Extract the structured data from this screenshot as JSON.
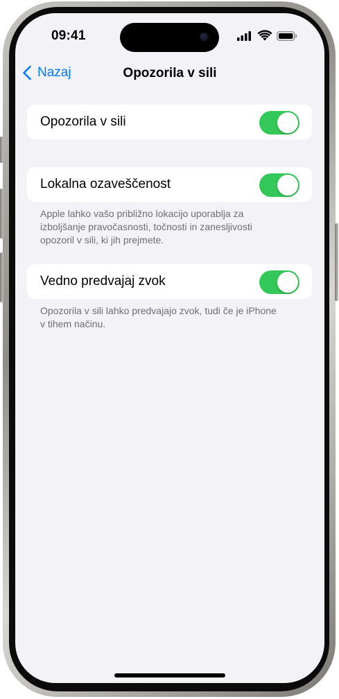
{
  "status_bar": {
    "time": "09:41",
    "icons": [
      "cellular-signal-icon",
      "wifi-icon",
      "battery-icon"
    ]
  },
  "nav": {
    "back_label": "Nazaj",
    "title": "Opozorila v sili"
  },
  "settings": [
    {
      "label": "Opozorila v sili",
      "enabled": true,
      "footnote": ""
    },
    {
      "label": "Lokalna ozaveščenost",
      "enabled": true,
      "footnote_lines": [
        "Apple lahko vašo približno lokacijo uporablja za",
        "izboljšanje pravočasnosti, točnosti in zanesljivosti",
        "opozoril v sili, ki jih prejmete."
      ]
    },
    {
      "label": "Vedno predvajaj zvok",
      "enabled": true,
      "footnote_lines": [
        "Opozorila v sili lahko predvajajo zvok, tudi če je iPhone",
        "v tihem načinu."
      ]
    }
  ],
  "colors": {
    "accent": "#007aff",
    "toggle_on": "#34c759",
    "background": "#f2f2f7",
    "footnote": "#6d6d72"
  }
}
